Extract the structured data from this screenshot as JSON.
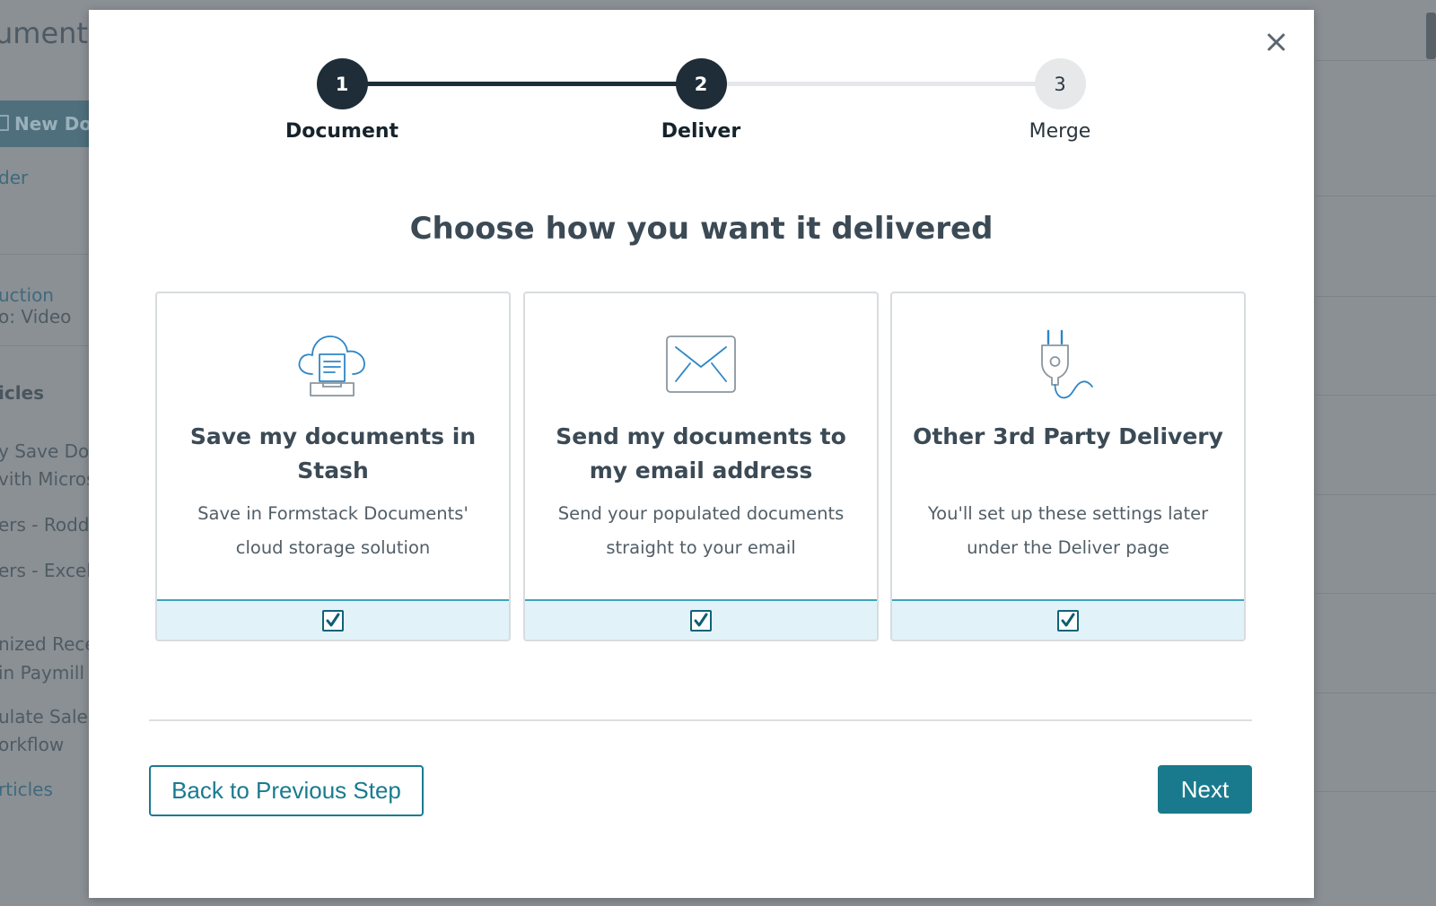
{
  "background": {
    "title": "uments",
    "new_document_label": "New Do",
    "sidebar_lines": [
      {
        "text": "der",
        "kind": "link"
      },
      {
        "text": "uction",
        "kind": "link"
      },
      {
        "text": "o: Video",
        "kind": "text"
      },
      {
        "text": "icles",
        "kind": "head"
      },
      {
        "text": "y Save Doc",
        "kind": "text"
      },
      {
        "text": "vith Micros",
        "kind": "text"
      },
      {
        "text": "ers - Rodd",
        "kind": "text"
      },
      {
        "text": "ers - Excel",
        "kind": "text"
      },
      {
        "text": "nized Rece",
        "kind": "text"
      },
      {
        "text": " in Paymill",
        "kind": "text"
      },
      {
        "text": "ulate Sales",
        "kind": "text"
      },
      {
        "text": "orkflow",
        "kind": "text"
      },
      {
        "text": "rticles",
        "kind": "link"
      }
    ]
  },
  "modal": {
    "close_icon": "close-icon",
    "stepper": {
      "steps": [
        {
          "number": "1",
          "label": "Document",
          "state": "complete"
        },
        {
          "number": "2",
          "label": "Deliver",
          "state": "current"
        },
        {
          "number": "3",
          "label": "Merge",
          "state": "pending"
        }
      ]
    },
    "heading": "Choose how you want it delivered",
    "options": [
      {
        "icon": "cloud-document-icon",
        "title": "Save my documents in Stash",
        "description": "Save in Formstack Documents' cloud storage solution",
        "checked": true
      },
      {
        "icon": "envelope-icon",
        "title": "Send my documents to my email address",
        "description": "Send your populated documents straight to your email",
        "checked": true
      },
      {
        "icon": "plug-icon",
        "title": "Other 3rd Party Delivery",
        "description": "You'll set up these settings later under the Deliver page",
        "checked": true
      }
    ],
    "back_button": "Back to Previous Step",
    "next_button": "Next"
  },
  "colors": {
    "accent": "#1a7a8d",
    "step_active": "#1e2d37",
    "card_footer_bg": "#e1f3f8",
    "icon_stroke": "#2f86c5"
  }
}
